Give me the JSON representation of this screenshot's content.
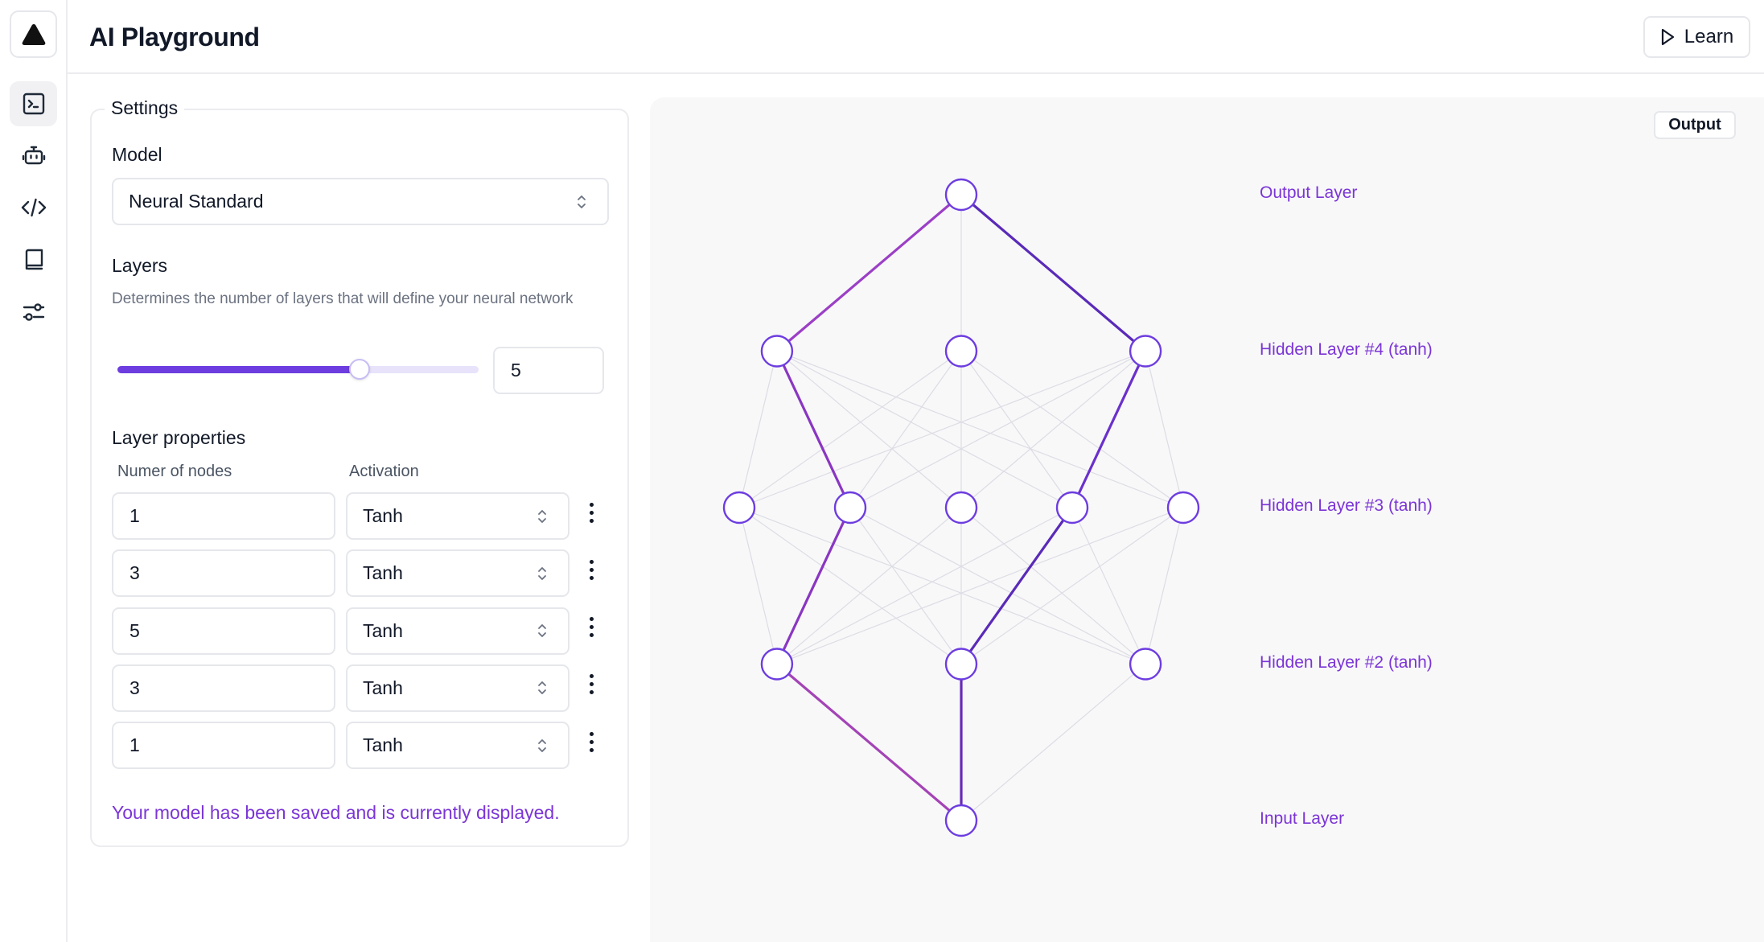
{
  "app": {
    "title": "AI Playground"
  },
  "header": {
    "learn_label": "Learn"
  },
  "sidebar": {
    "items": [
      {
        "name": "terminal",
        "active": true
      },
      {
        "name": "robot",
        "active": false
      },
      {
        "name": "code",
        "active": false
      },
      {
        "name": "book",
        "active": false
      },
      {
        "name": "sliders",
        "active": false
      }
    ]
  },
  "settings": {
    "legend": "Settings",
    "model_label": "Model",
    "model_value": "Neural Standard",
    "layers_label": "Layers",
    "layers_description": "Determines the number of layers that will define your neural network",
    "layers_slider_fraction": 0.67,
    "layers_value": "5",
    "layer_properties_label": "Layer properties",
    "col_nodes": "Numer of nodes",
    "col_activation": "Activation",
    "rows": [
      {
        "nodes": "1",
        "activation": "Tanh"
      },
      {
        "nodes": "3",
        "activation": "Tanh"
      },
      {
        "nodes": "5",
        "activation": "Tanh"
      },
      {
        "nodes": "3",
        "activation": "Tanh"
      },
      {
        "nodes": "1",
        "activation": "Tanh"
      }
    ],
    "status": "Your model has been saved and is currently displayed."
  },
  "viz": {
    "output_badge": "Output",
    "layers": [
      {
        "label": "Output Layer",
        "nodes": 1
      },
      {
        "label": "Hidden Layer #4 (tanh)",
        "nodes": 3
      },
      {
        "label": "Hidden Layer #3 (tanh)",
        "nodes": 5
      },
      {
        "label": "Hidden Layer #2 (tanh)",
        "nodes": 3
      },
      {
        "label": "Input Layer",
        "nodes": 1
      }
    ],
    "colors": {
      "accent": "#7b35d6",
      "node_stroke": "#6d3de0",
      "edge_faint": "#dcdce4"
    }
  }
}
